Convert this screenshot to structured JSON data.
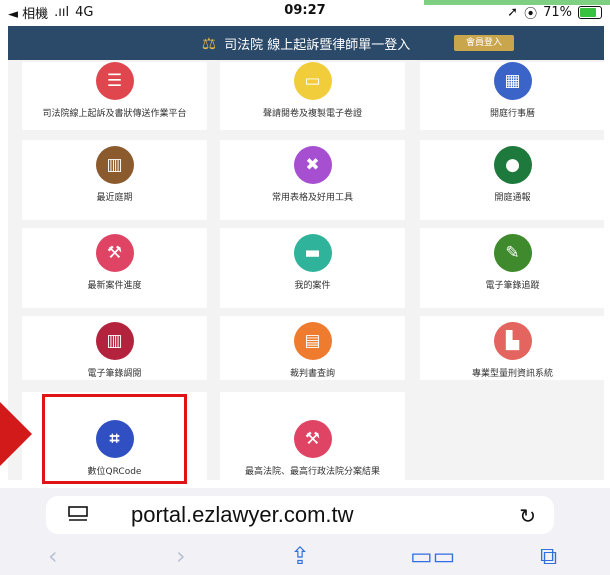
{
  "status": {
    "carrier": "◄ 相機",
    "signal": ".ııl",
    "network": "4G",
    "time": "09:27",
    "location": "➚",
    "lock": "⦿",
    "battery": "71%"
  },
  "header": {
    "logo_icon": "scales-icon",
    "title": "司法院 線上起訴暨律師單一登入",
    "login_label": "會員登入"
  },
  "grid": {
    "items": [
      {
        "label": "司法院線上起訴及書狀傳送作業平台",
        "icon": "document-stack-icon",
        "color": "#e0464e",
        "glyph": "☰"
      },
      {
        "label": "聲請閱卷及複製電子卷證",
        "icon": "folder-icon",
        "color": "#f1cd3c",
        "glyph": "▭"
      },
      {
        "label": "開庭行事曆",
        "icon": "calendar-icon",
        "color": "#3b64c8",
        "glyph": "▦"
      },
      {
        "label": "最近庭期",
        "icon": "courthouse-icon",
        "color": "#8b5b2e",
        "glyph": "▥"
      },
      {
        "label": "常用表格及好用工具",
        "icon": "tools-icon",
        "color": "#a64fd0",
        "glyph": "✖"
      },
      {
        "label": "開庭通報",
        "icon": "group-icon",
        "color": "#1e7a3c",
        "glyph": "●"
      },
      {
        "label": "最新案件進度",
        "icon": "gavel-icon",
        "color": "#e04465",
        "glyph": "⚒"
      },
      {
        "label": "我的案件",
        "icon": "briefcase-icon",
        "color": "#2fb39a",
        "glyph": "▬"
      },
      {
        "label": "電子筆錄追蹤",
        "icon": "pen-icon",
        "color": "#3f8a2c",
        "glyph": "✎"
      },
      {
        "label": "電子筆錄調閱",
        "icon": "books-icon",
        "color": "#b4233e",
        "glyph": "▥"
      },
      {
        "label": "裁判書查詢",
        "icon": "scroll-icon",
        "color": "#ef7b2e",
        "glyph": "▤"
      },
      {
        "label": "專業型量刑資訊系統",
        "icon": "chart-icon",
        "color": "#e4645f",
        "glyph": "▙"
      },
      {
        "label": "數位QRCode",
        "icon": "qrcode-icon",
        "color": "#2f4fc2",
        "glyph": "⌗"
      },
      {
        "label": "最高法院、最高行政法院分案結果",
        "icon": "gavel-icon",
        "color": "#e04465",
        "glyph": "⚒"
      }
    ]
  },
  "browser": {
    "url": "portal.ezlawyer.com.tw",
    "reload_icon": "reload-icon",
    "back_icon": "back-icon",
    "forward_icon": "forward-icon",
    "share_icon": "share-icon",
    "bookmarks_icon": "bookmarks-icon",
    "tabs_icon": "tabs-icon"
  }
}
